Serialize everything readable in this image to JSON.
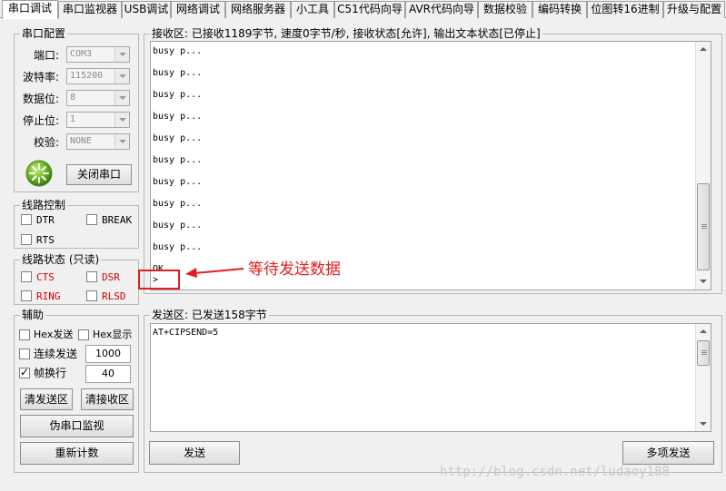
{
  "tabs": [
    "串口调试",
    "串口监视器",
    "USB调试",
    "网络调试",
    "网络服务器",
    "小工具",
    "C51代码向导",
    "AVR代码向导",
    "数据校验",
    "编码转换",
    "位图转16进制",
    "升级与配置"
  ],
  "serial_config": {
    "title": "串口配置",
    "port_label": "端口:",
    "port_value": "COM3",
    "baud_label": "波特率:",
    "baud_value": "115200",
    "databits_label": "数据位:",
    "databits_value": "8",
    "stopbits_label": "停止位:",
    "stopbits_value": "1",
    "parity_label": "校验:",
    "parity_value": "NONE",
    "close_button": "关闭串口"
  },
  "line_control": {
    "title": "线路控制",
    "dtr": "DTR",
    "break": "BREAK",
    "rts": "RTS"
  },
  "line_status": {
    "title": "线路状态 (只读)",
    "cts": "CTS",
    "dsr": "DSR",
    "ring": "RING",
    "rlsd": "RLSD"
  },
  "assist": {
    "title": "辅助",
    "hex_send": "Hex发送",
    "hex_show": "Hex显示",
    "continuous_send": "连续发送",
    "continuous_value": "1000",
    "frame_wrap": "帧换行",
    "frame_value": "40",
    "clear_send": "清发送区",
    "clear_recv": "清接收区",
    "fake_monitor": "伪串口监视",
    "reset_count": "重新计数"
  },
  "receive": {
    "title": "接收区: 已接收1189字节, 速度0字节/秒, 接收状态[允许], 输出文本状态[已停止]",
    "lines": [
      "busy p...",
      "busy p...",
      "busy p...",
      "busy p...",
      "busy p...",
      "busy p...",
      "busy p...",
      "busy p...",
      "busy p...",
      "busy p...",
      "OK",
      ">"
    ]
  },
  "annotation": "等待发送数据",
  "send": {
    "title": "发送区: 已发送158字节",
    "content": "AT+CIPSEND=5",
    "send_button": "发送",
    "multi_send_button": "多项发送"
  },
  "watermark": "http://blog.csdn.net/ludaoy188",
  "colors": {
    "status_red": "#d40000",
    "annotation_red": "#e02020",
    "accent_green": "#6ab023"
  }
}
